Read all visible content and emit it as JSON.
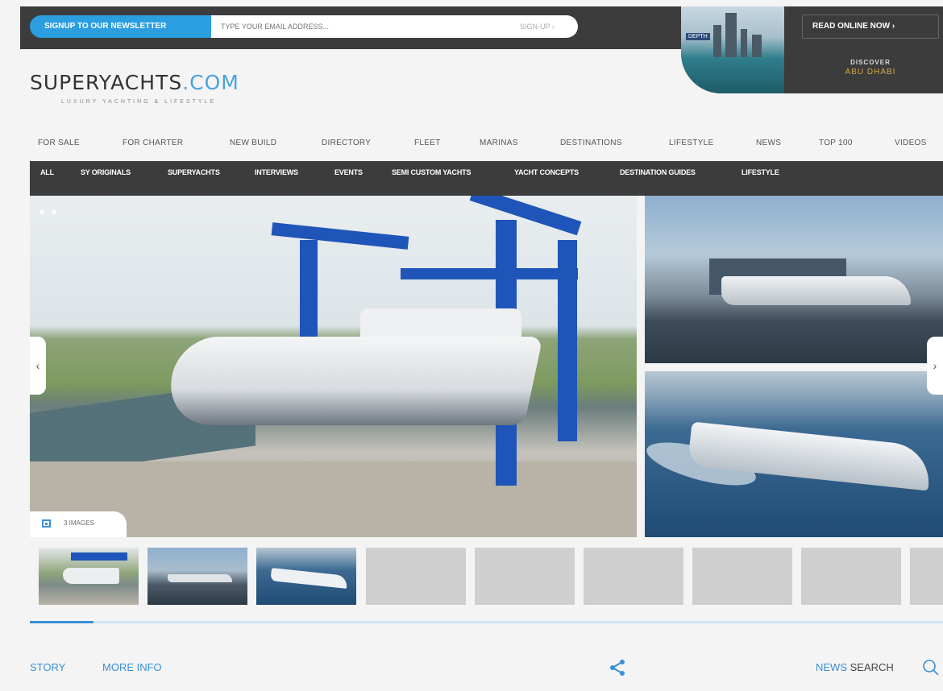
{
  "newsletter": {
    "tag": "SIGNUP TO OUR NEWSLETTER",
    "placeholder": "TYPE YOUR EMAIL ADDRESS...",
    "signup": "SIGN-UP ›"
  },
  "ad": {
    "logo": "DEPTH",
    "read": "READ ONLINE NOW ›",
    "discover": "DISCOVER",
    "place": "ABU DHABI"
  },
  "brand": {
    "name": "SUPERYACHTS",
    "dotcom": ".COM",
    "tagline": "LUXURY YACHTING & LIFESTYLE"
  },
  "mainnav": [
    "FOR SALE",
    "FOR CHARTER",
    "NEW BUILD",
    "DIRECTORY",
    "FLEET",
    "MARINAS",
    "DESTINATIONS",
    "LIFESTYLE",
    "NEWS",
    "TOP 100",
    "VIDEOS"
  ],
  "subnav": [
    "ALL",
    "SY ORIGINALS",
    "SUPERYACHTS",
    "INTERVIEWS",
    "EVENTS",
    "SEMI CUSTOM YACHTS",
    "YACHT CONCEPTS",
    "DESTINATION GUIDES",
    "LIFESTYLE"
  ],
  "gallery": {
    "count_label": "3 IMAGES",
    "prev": "‹",
    "next": "›",
    "progress": 0.07
  },
  "footer": {
    "story": "STORY",
    "more": "MORE INFO",
    "news": "NEWS",
    "search": "SEARCH"
  },
  "colors": {
    "accent": "#3a8fd6",
    "dark": "#3c3c3c",
    "gold": "#d4a74a"
  }
}
